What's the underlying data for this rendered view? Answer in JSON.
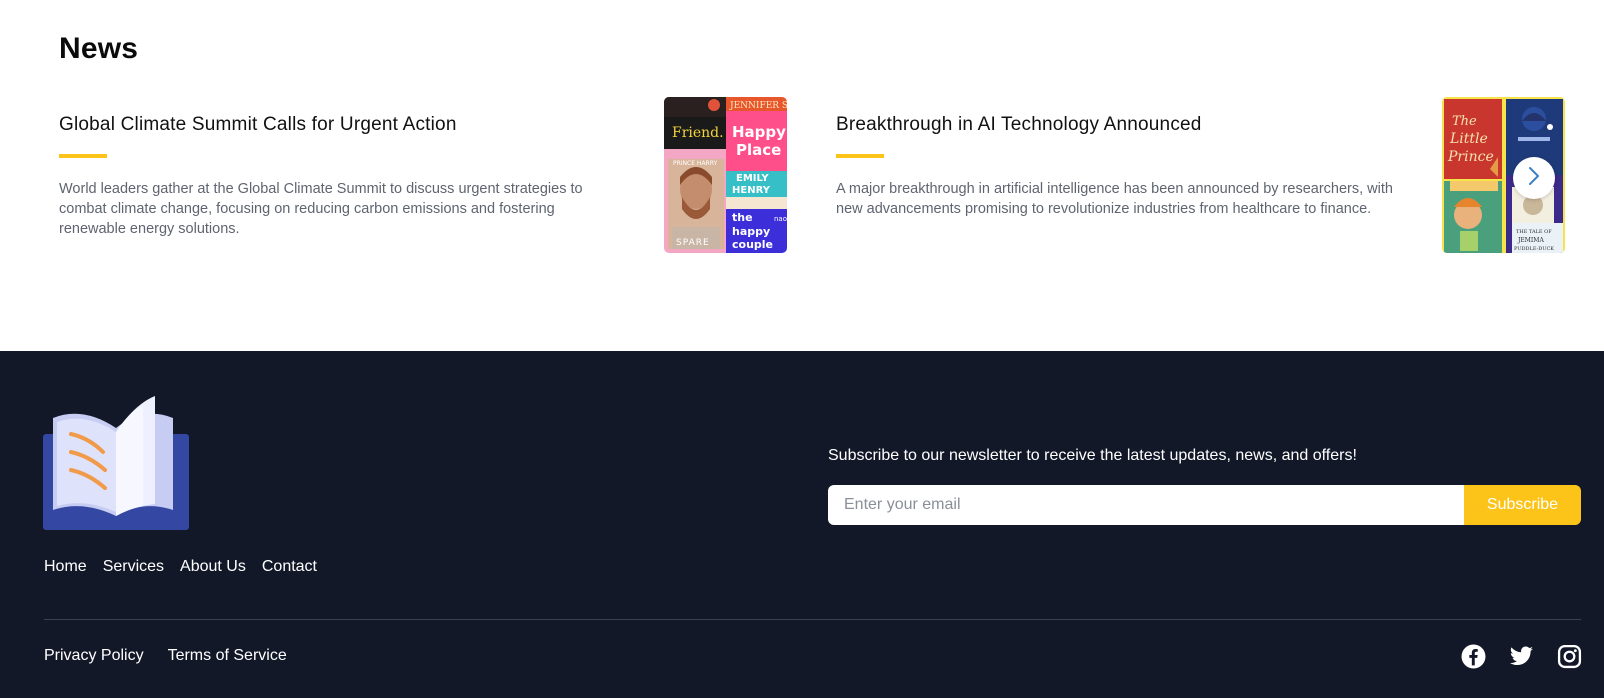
{
  "news": {
    "heading": "News",
    "articles": [
      {
        "title": "Global Climate Summit Calls for Urgent Action",
        "body": "World leaders gather at the Global Climate Summit to discuss urgent strategies to combat climate change, focusing on reducing carbon emissions and fostering renewable energy solutions.",
        "thumbnail_texts": [
          "Friend.",
          "JENNIFER SAI",
          "Happy",
          "Place",
          "EMILY",
          "HENRY",
          "PRINCE HARRY",
          "SPARE",
          "the",
          "happy",
          "couple",
          "naoi"
        ]
      },
      {
        "title": "Breakthrough in AI Technology Announced",
        "body": "A major breakthrough in artificial intelligence has been announced by researchers, with new advancements promising to revolutionize industries from healthcare to finance.",
        "thumbnail_texts": [
          "The",
          "Little",
          "Prince",
          "THE TALE OF",
          "JEMIMA",
          "PUDDLE-DUCK"
        ]
      }
    ],
    "next_icon": "chevron-right-icon"
  },
  "footer": {
    "logo_icon": "open-book-icon",
    "nav": [
      "Home",
      "Services",
      "About Us",
      "Contact"
    ],
    "newsletter": {
      "text": "Subscribe to our newsletter to receive the latest updates, news, and offers!",
      "placeholder": "Enter your email",
      "button": "Subscribe"
    },
    "legal": [
      "Privacy Policy",
      "Terms of Service"
    ],
    "social_icons": [
      "facebook-icon",
      "twitter-icon",
      "instagram-icon"
    ]
  },
  "colors": {
    "accent": "#fcc419",
    "footer_bg": "#121828",
    "body_text": "#5f6470"
  }
}
